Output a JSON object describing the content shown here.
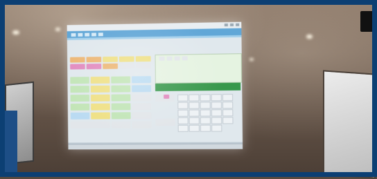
{
  "scene": {
    "description_hidden": "",
    "colors": {
      "frame": "#0c3f73",
      "toolbar": "#5ba8de",
      "amount_bar": "#2f9b45"
    }
  },
  "screen": {
    "window_title": "",
    "amount_label": "",
    "amount_value": "",
    "icons": [
      "app-icon",
      "minimize-icon",
      "maximize-icon",
      "close-icon"
    ]
  }
}
